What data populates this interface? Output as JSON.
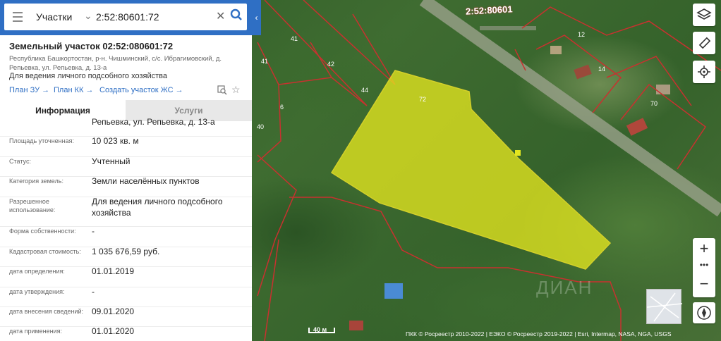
{
  "search": {
    "type_label": "Участки",
    "value": "2:52:80601:72"
  },
  "parcel": {
    "title": "Земельный участок 02:52:080601:72",
    "address": "Республика Башкортостан, р-н. Чишминский, с/с. Ибрагимовский, д. Репьевка, ул. Репьевка, д. 13-а",
    "purpose": "Для ведения личного подсобного хозяйства",
    "links": {
      "plan_zu": "План ЗУ →",
      "plan_kk": "План КК →",
      "create": "Создать участок ЖС →"
    }
  },
  "tabs": {
    "info": "Информация",
    "services": "Услуги"
  },
  "info": {
    "cut_text": "Репьевка, ул. Репьевка, д. 13-а",
    "rows": [
      {
        "label": "Площадь уточненная:",
        "value": "10 023 кв. м"
      },
      {
        "label": "Статус:",
        "value": "Учтенный"
      },
      {
        "label": "Категория земель:",
        "value": "Земли населённых пунктов"
      },
      {
        "label": "Разрешенное использование:",
        "value": "Для ведения личного подсобного хозяйства"
      },
      {
        "label": "Форма собственности:",
        "value": "-"
      },
      {
        "label": "Кадастровая стоимость:",
        "value": "1 035 676,59 руб."
      },
      {
        "label": "дата определения:",
        "value": "01.01.2019"
      },
      {
        "label": "дата утверждения:",
        "value": "-"
      },
      {
        "label": "дата внесения сведений:",
        "value": "09.01.2020"
      },
      {
        "label": "дата применения:",
        "value": "01.01.2020"
      }
    ]
  },
  "map": {
    "selected_label": "72",
    "cadastral_top": "2:52:80601",
    "plot_numbers": [
      "41",
      "41",
      "42",
      "44",
      "6",
      "40",
      "12",
      "14",
      "70"
    ],
    "scale": "40 м",
    "attribution": "ПКК © Росреестр 2010-2022 | ЕЭКО © Росреестр 2019-2022 | Esri, Intermap, NASA, NGA, USGS",
    "watermark": "ДИАН",
    "selected_fill": "#e3e61f",
    "boundary_color": "#c8312f"
  },
  "controls": {
    "zoom_in": "+",
    "zoom_more": "•••",
    "zoom_out": "−"
  },
  "icons": {
    "menu": "menu-icon",
    "chevron": "chevron-down-icon",
    "clear": "close-icon",
    "search": "search-icon",
    "layers": "layers-icon",
    "ruler": "ruler-icon",
    "locate": "crosshair-icon",
    "compass": "compass-icon",
    "star": "star-icon"
  }
}
